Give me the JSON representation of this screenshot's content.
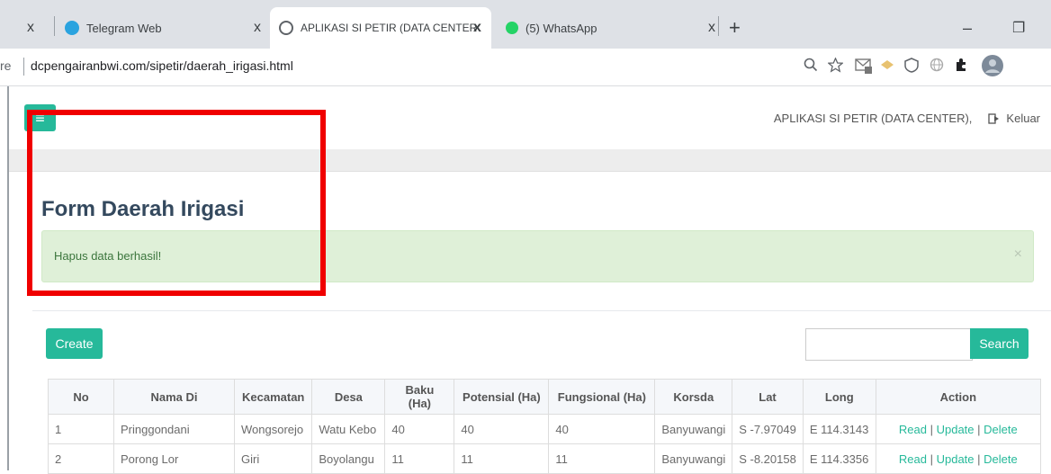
{
  "browser": {
    "tabs": [
      {
        "label": "Telegram Web",
        "close": "x"
      },
      {
        "label": "APLIKASI SI PETIR (DATA CENTER",
        "close": "x"
      },
      {
        "label": "(5) WhatsApp",
        "close": "x"
      }
    ],
    "new_tab": "+",
    "first_tab_close": "x",
    "url_prefix": "re",
    "url": "dcpengairanbwi.com/sipetir/daerah_irigasi.html",
    "minimize": "–",
    "restore": "❐"
  },
  "header": {
    "menu_icon": "≡",
    "app_name": "APLIKASI SI PETIR (DATA CENTER),",
    "logout": "Keluar"
  },
  "main": {
    "title": "Form Daerah Irigasi",
    "alert": {
      "message": "Hapus data berhasil!",
      "close": "×"
    },
    "create_label": "Create",
    "search_label": "Search",
    "search_value": ""
  },
  "table": {
    "columns": [
      "No",
      "Nama Di",
      "Kecamatan",
      "Desa",
      "Baku (Ha)",
      "Potensial (Ha)",
      "Fungsional (Ha)",
      "Korsda",
      "Lat",
      "Long",
      "Action"
    ],
    "rows": [
      {
        "no": "1",
        "nama": "Pringgondani",
        "kecamatan": "Wongsorejo",
        "desa": "Watu Kebo",
        "baku": "40",
        "potensial": "40",
        "fungsional": "40",
        "korsda": "Banyuwangi",
        "lat": "S -7.97049",
        "long": "E 114.3143"
      },
      {
        "no": "2",
        "nama": "Porong Lor",
        "kecamatan": "Giri",
        "desa": "Boyolangu",
        "baku": "11",
        "potensial": "11",
        "fungsional": "11",
        "korsda": "Banyuwangi",
        "lat": "S -8.20158",
        "long": "E 114.3356"
      }
    ],
    "actions": {
      "read": "Read",
      "update": "Update",
      "delete": "Delete",
      "sep": "|"
    }
  },
  "colors": {
    "accent": "#26b99a",
    "alert_bg": "#dff0d8",
    "highlight_box": "#f00000"
  }
}
